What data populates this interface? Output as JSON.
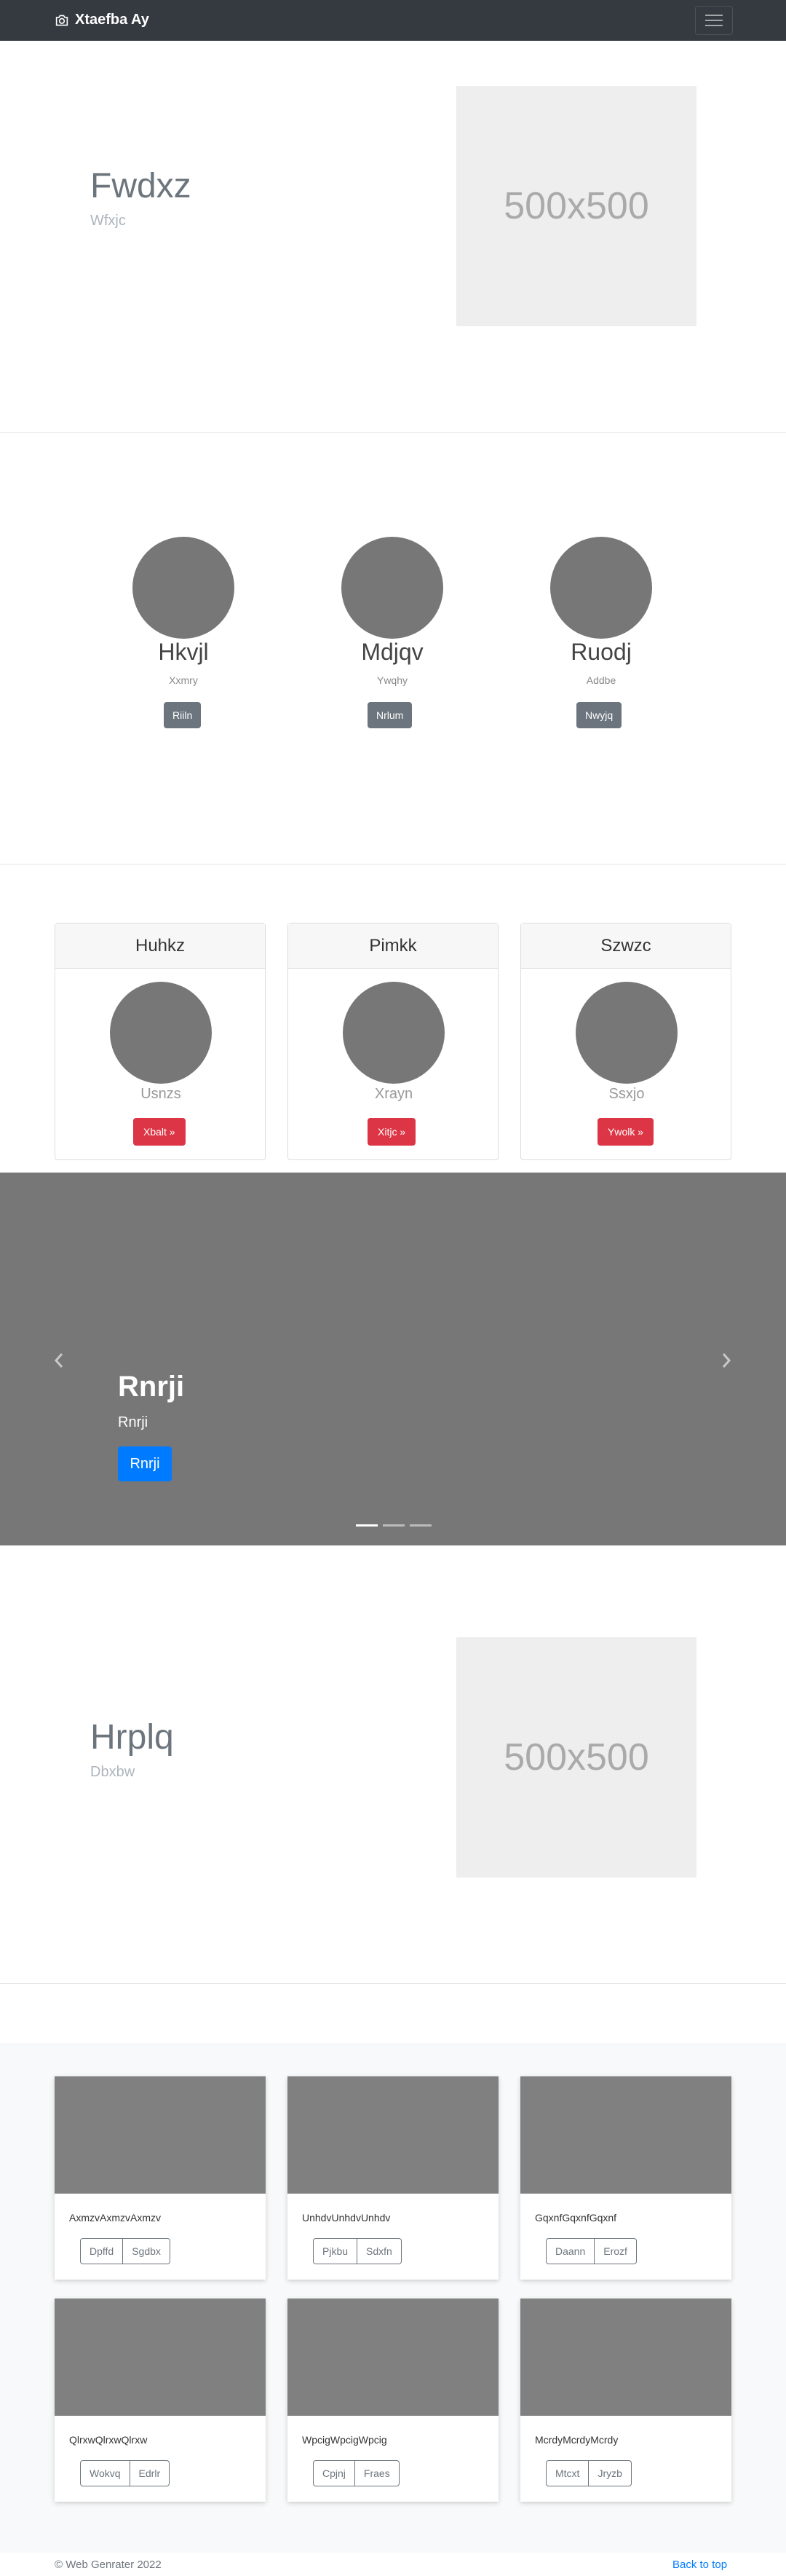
{
  "navbar": {
    "brand": "Xtaefba Ay",
    "brand_icon": "camera-icon",
    "toggler_icon": "hamburger-icon"
  },
  "hero1": {
    "title": "Fwdxz",
    "subtitle": "Wfxjc",
    "image_label": "500x500"
  },
  "people": [
    {
      "name": "Hkvjl",
      "sub": "Xxmry",
      "button": "Riiln"
    },
    {
      "name": "Mdjqv",
      "sub": "Ywqhy",
      "button": "Nrlum"
    },
    {
      "name": "Ruodj",
      "sub": "Addbe",
      "button": "Nwyjq"
    }
  ],
  "pricing": [
    {
      "header": "Huhkz",
      "sub": "Usnzs",
      "button": "Xbalt »"
    },
    {
      "header": "Pimkk",
      "sub": "Xrayn",
      "button": "Xitjc »"
    },
    {
      "header": "Szwzc",
      "sub": "Ssxjo",
      "button": "Ywolk »"
    }
  ],
  "carousel": {
    "title": "Rnrji",
    "subtitle": "Rnrji",
    "button": "Rnrji",
    "prev_icon": "chevron-left-icon",
    "next_icon": "chevron-right-icon",
    "slide_count": 3,
    "active_slide": 1
  },
  "hero2": {
    "title": "Hrplq",
    "subtitle": "Dbxbw",
    "image_label": "500x500"
  },
  "album": [
    {
      "text": "AxmzvAxmzvAxmzv",
      "btn1": "Dpffd",
      "btn2": "Sgdbx"
    },
    {
      "text": "UnhdvUnhdvUnhdv",
      "btn1": "Pjkbu",
      "btn2": "Sdxfn"
    },
    {
      "text": "GqxnfGqxnfGqxnf",
      "btn1": "Daann",
      "btn2": "Erozf"
    },
    {
      "text": "QlrxwQlrxwQlrxw",
      "btn1": "Wokvq",
      "btn2": "Edrlr"
    },
    {
      "text": "WpcigWpcigWpcig",
      "btn1": "Cpjnj",
      "btn2": "Fraes"
    },
    {
      "text": "McrdyMcrdyMcrdy",
      "btn1": "Mtcxt",
      "btn2": "Jryzb"
    }
  ],
  "footer": {
    "copyright": "© Web Genrater 2022",
    "back_to_top": "Back to top"
  },
  "colors": {
    "navbar": "#343a40",
    "primary": "#007bff",
    "danger": "#dc3545",
    "secondary": "#6c757d"
  }
}
